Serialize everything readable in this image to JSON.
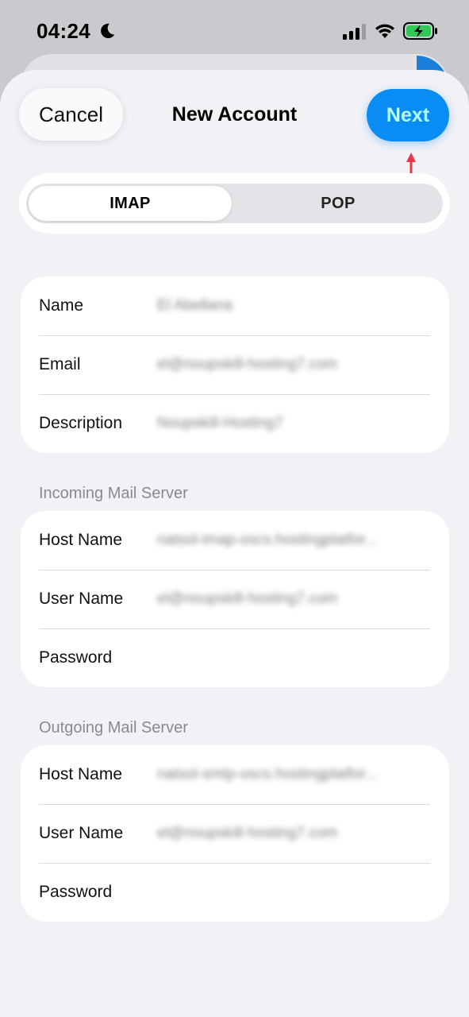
{
  "status_bar": {
    "time": "04:24",
    "icons": [
      "moon-icon",
      "signal-icon",
      "wifi-icon",
      "battery-charging-icon"
    ],
    "battery_color": "#34c759"
  },
  "nav": {
    "cancel_label": "Cancel",
    "title": "New Account",
    "next_label": "Next",
    "accent_color": "#0a8cf5"
  },
  "segment": {
    "options": [
      "IMAP",
      "POP"
    ],
    "selected": "IMAP"
  },
  "account": {
    "rows": [
      {
        "label": "Name",
        "value": "El Abellana"
      },
      {
        "label": "Email",
        "value": "el@noupskill-hosting7.com"
      },
      {
        "label": "Description",
        "value": "Noupskill-Hosting7"
      }
    ]
  },
  "incoming": {
    "header": "Incoming Mail Server",
    "rows": [
      {
        "label": "Host Name",
        "value": "natsol-imap-oscs.hostingplatfor..."
      },
      {
        "label": "User Name",
        "value": "el@noupskill-hosting7.com"
      },
      {
        "label": "Password",
        "value": ""
      }
    ]
  },
  "outgoing": {
    "header": "Outgoing Mail Server",
    "rows": [
      {
        "label": "Host Name",
        "value": "natsol-smtp-oscs.hostingplatfor..."
      },
      {
        "label": "User Name",
        "value": "el@noupskill-hosting7.com"
      },
      {
        "label": "Password",
        "value": ""
      }
    ]
  }
}
